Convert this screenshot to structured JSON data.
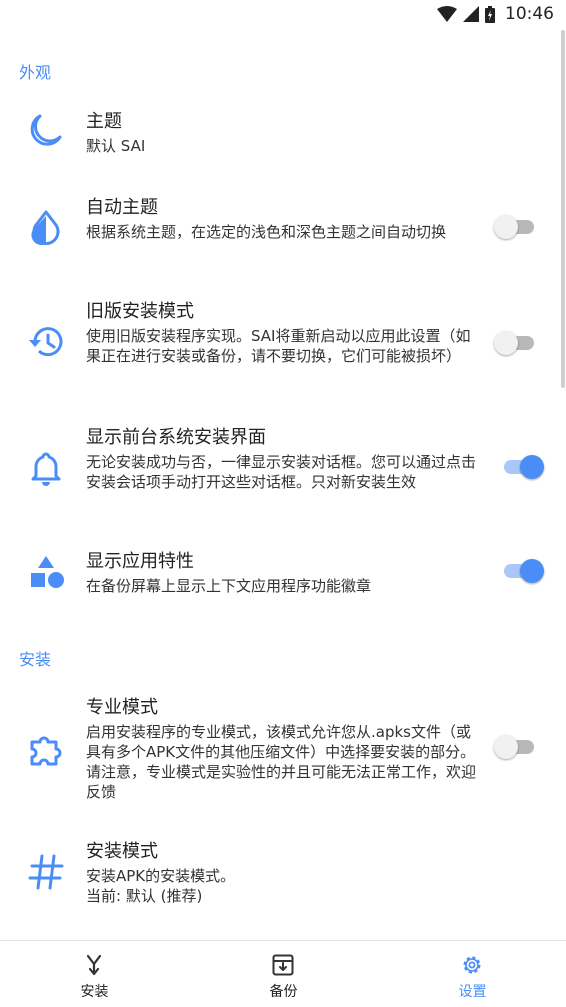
{
  "status_bar": {
    "time": "10:46"
  },
  "colors": {
    "accent": "#4a8df6",
    "text": "#222222"
  },
  "sections": {
    "appearance": "外观",
    "install": "安装"
  },
  "prefs": {
    "theme": {
      "title": "主题",
      "summary": "默认 SAI",
      "icon": "moon-icon"
    },
    "auto_theme": {
      "title": "自动主题",
      "summary": "根据系统主题，在选定的浅色和深色主题之间自动切换",
      "icon": "water-drop-icon",
      "enabled": false
    },
    "legacy_install": {
      "title": "旧版安装模式",
      "summary": "使用旧版安装程序实现。SAI将重新启动以应用此设置（如果正在进行安装或备份，请不要切换，它们可能被损坏）",
      "icon": "history-icon",
      "enabled": false
    },
    "show_installer": {
      "title": "显示前台系统安装界面",
      "summary": "无论安装成功与否，一律显示安装对话框。您可以通过点击安装会话项手动打开这些对话框。只对新安装生效",
      "icon": "bell-icon",
      "enabled": true
    },
    "app_features": {
      "title": "显示应用特性",
      "summary": "在备份屏幕上显示上下文应用程序功能徽章",
      "icon": "shapes-icon",
      "enabled": true
    },
    "pro_mode": {
      "title": "专业模式",
      "summary": "启用安装程序的专业模式，该模式允许您从.apks文件（或具有多个APK文件的其他压缩文件）中选择要安装的部分。 请注意，专业模式是实验性的并且可能无法正常工作，欢迎反馈",
      "icon": "puzzle-icon",
      "enabled": false
    },
    "install_mode": {
      "title": "安装模式",
      "summary": "安装APK的安装模式。\n当前: 默认 (推荐)",
      "icon": "hash-icon"
    }
  },
  "bottom_nav": {
    "items": [
      {
        "label": "安装",
        "icon": "install-icon",
        "active": false
      },
      {
        "label": "备份",
        "icon": "backup-icon",
        "active": false
      },
      {
        "label": "设置",
        "icon": "settings-icon",
        "active": true
      }
    ]
  }
}
